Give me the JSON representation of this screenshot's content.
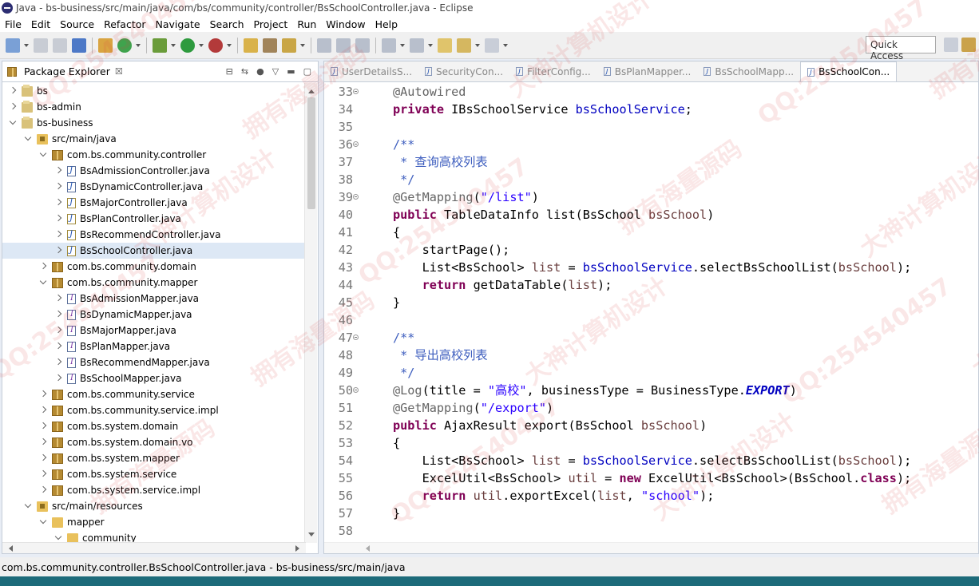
{
  "window": {
    "title": "Java - bs-business/src/main/java/com/bs/community/controller/BsSchoolController.java - Eclipse"
  },
  "menu": [
    "File",
    "Edit",
    "Source",
    "Refactor",
    "Navigate",
    "Search",
    "Project",
    "Run",
    "Window",
    "Help"
  ],
  "toolbar": {
    "quick_access_placeholder": "Quick Access"
  },
  "package_explorer": {
    "title": "Package Explorer",
    "close": "☒",
    "tree": [
      {
        "label": "bs",
        "icon": "project",
        "level": 0,
        "state": "r"
      },
      {
        "label": "bs-admin",
        "icon": "project",
        "level": 0,
        "state": "r"
      },
      {
        "label": "bs-business",
        "icon": "project",
        "level": 0,
        "state": "d"
      },
      {
        "label": "src/main/java",
        "icon": "srcfolder",
        "level": 1,
        "state": "d"
      },
      {
        "label": "com.bs.community.controller",
        "icon": "pkg",
        "level": 2,
        "state": "d"
      },
      {
        "label": "BsAdmissionController.java",
        "icon": "java",
        "level": 3,
        "state": "r"
      },
      {
        "label": "BsDynamicController.java",
        "icon": "java",
        "level": 3,
        "state": "r"
      },
      {
        "label": "BsMajorController.java",
        "icon": "java warn",
        "level": 3,
        "state": "r"
      },
      {
        "label": "BsPlanController.java",
        "icon": "java warn",
        "level": 3,
        "state": "r"
      },
      {
        "label": "BsRecommendController.java",
        "icon": "java warn",
        "level": 3,
        "state": "r"
      },
      {
        "label": "BsSchoolController.java",
        "icon": "java warn",
        "level": 3,
        "state": "r",
        "selected": true
      },
      {
        "label": "com.bs.community.domain",
        "icon": "pkg",
        "level": 2,
        "state": "r"
      },
      {
        "label": "com.bs.community.mapper",
        "icon": "pkg",
        "level": 2,
        "state": "d"
      },
      {
        "label": "BsAdmissionMapper.java",
        "icon": "iface",
        "level": 3,
        "state": "r"
      },
      {
        "label": "BsDynamicMapper.java",
        "icon": "iface",
        "level": 3,
        "state": "r"
      },
      {
        "label": "BsMajorMapper.java",
        "icon": "iface",
        "level": 3,
        "state": "r"
      },
      {
        "label": "BsPlanMapper.java",
        "icon": "iface",
        "level": 3,
        "state": "r"
      },
      {
        "label": "BsRecommendMapper.java",
        "icon": "iface",
        "level": 3,
        "state": "r"
      },
      {
        "label": "BsSchoolMapper.java",
        "icon": "iface",
        "level": 3,
        "state": "r"
      },
      {
        "label": "com.bs.community.service",
        "icon": "pkg",
        "level": 2,
        "state": "r"
      },
      {
        "label": "com.bs.community.service.impl",
        "icon": "pkg",
        "level": 2,
        "state": "r"
      },
      {
        "label": "com.bs.system.domain",
        "icon": "pkg",
        "level": 2,
        "state": "r"
      },
      {
        "label": "com.bs.system.domain.vo",
        "icon": "pkg",
        "level": 2,
        "state": "r"
      },
      {
        "label": "com.bs.system.mapper",
        "icon": "pkg",
        "level": 2,
        "state": "r"
      },
      {
        "label": "com.bs.system.service",
        "icon": "pkg",
        "level": 2,
        "state": "r"
      },
      {
        "label": "com.bs.system.service.impl",
        "icon": "pkg",
        "level": 2,
        "state": "r"
      },
      {
        "label": "src/main/resources",
        "icon": "srcfolder",
        "level": 1,
        "state": "d"
      },
      {
        "label": "mapper",
        "icon": "folder",
        "level": 2,
        "state": "d"
      },
      {
        "label": "community",
        "icon": "folder",
        "level": 3,
        "state": "d"
      }
    ]
  },
  "editor_tabs": [
    {
      "label": "UserDetailsS...",
      "active": false
    },
    {
      "label": "SecurityCon...",
      "active": false
    },
    {
      "label": "FilterConfig...",
      "active": false
    },
    {
      "label": "BsPlanMapper...",
      "active": false
    },
    {
      "label": "BsSchoolMapp...",
      "active": false
    },
    {
      "label": "BsSchoolCon...",
      "active": true
    }
  ],
  "code_lines": [
    {
      "n": "33",
      "fold": true,
      "html": "<span class=\"an\">@Autowired</span>"
    },
    {
      "n": "34",
      "html": "<span class=\"kw\">private</span> IBsSchoolService <span class=\"fd\">bsSchoolService</span>;"
    },
    {
      "n": "35",
      "html": ""
    },
    {
      "n": "36",
      "fold": true,
      "html": "<span class=\"cm\">/**</span>"
    },
    {
      "n": "37",
      "html": "<span class=\"cm\"> * 查询高校列表</span>"
    },
    {
      "n": "38",
      "html": "<span class=\"cm\"> */</span>"
    },
    {
      "n": "39",
      "fold": true,
      "html": "<span class=\"an\">@GetMapping</span>(<span class=\"st\">\"/list\"</span>)"
    },
    {
      "n": "40",
      "html": "<span class=\"kw\">public</span> TableDataInfo list(BsSchool <span class=\"vr\">bsSchool</span>)"
    },
    {
      "n": "41",
      "html": "{"
    },
    {
      "n": "42",
      "html": "    startPage();"
    },
    {
      "n": "43",
      "html": "    List&lt;BsSchool&gt; <span class=\"vr\">list</span> = <span class=\"fd\">bsSchoolService</span>.selectBsSchoolList(<span class=\"vr\">bsSchool</span>);"
    },
    {
      "n": "44",
      "html": "    <span class=\"kw\">return</span> getDataTable(<span class=\"vr\">list</span>);"
    },
    {
      "n": "45",
      "html": "}"
    },
    {
      "n": "46",
      "html": ""
    },
    {
      "n": "47",
      "fold": true,
      "html": "<span class=\"cm\">/**</span>"
    },
    {
      "n": "48",
      "html": "<span class=\"cm\"> * 导出高校列表</span>"
    },
    {
      "n": "49",
      "html": "<span class=\"cm\"> */</span>"
    },
    {
      "n": "50",
      "fold": true,
      "html": "<span class=\"an\">@Log</span>(title = <span class=\"st\">\"高校\"</span>, businessType = BusinessType.<span class=\"ec\">EXPORT</span>)"
    },
    {
      "n": "51",
      "html": "<span class=\"an\">@GetMapping</span>(<span class=\"st\">\"/export\"</span>)"
    },
    {
      "n": "52",
      "html": "<span class=\"kw\">public</span> AjaxResult export(BsSchool <span class=\"vr\">bsSchool</span>)"
    },
    {
      "n": "53",
      "html": "{"
    },
    {
      "n": "54",
      "html": "    List&lt;BsSchool&gt; <span class=\"vr\">list</span> = <span class=\"fd\">bsSchoolService</span>.selectBsSchoolList(<span class=\"vr\">bsSchool</span>);"
    },
    {
      "n": "55",
      "html": "    ExcelUtil&lt;BsSchool&gt; <span class=\"vr\">util</span> = <span class=\"kw\">new</span> ExcelUtil&lt;BsSchool&gt;(BsSchool.<span class=\"kw\">class</span>);"
    },
    {
      "n": "56",
      "html": "    <span class=\"kw\">return</span> <span class=\"vr\">util</span>.exportExcel(<span class=\"vr\">list</span>, <span class=\"st\">\"school\"</span>);"
    },
    {
      "n": "57",
      "fold": false,
      "html": "}"
    },
    {
      "n": "58",
      "html": ""
    }
  ],
  "status": {
    "text": "com.bs.community.controller.BsSchoolController.java - bs-business/src/main/java"
  },
  "watermarks": [
    "QQ:254540457",
    "拥有海量源码",
    "大神计算机设计"
  ],
  "colors": {
    "keyword": "#7f0055",
    "annotation": "#646464",
    "string": "#2a00ff",
    "comment": "#3f5fbf",
    "field": "#0000c0"
  }
}
